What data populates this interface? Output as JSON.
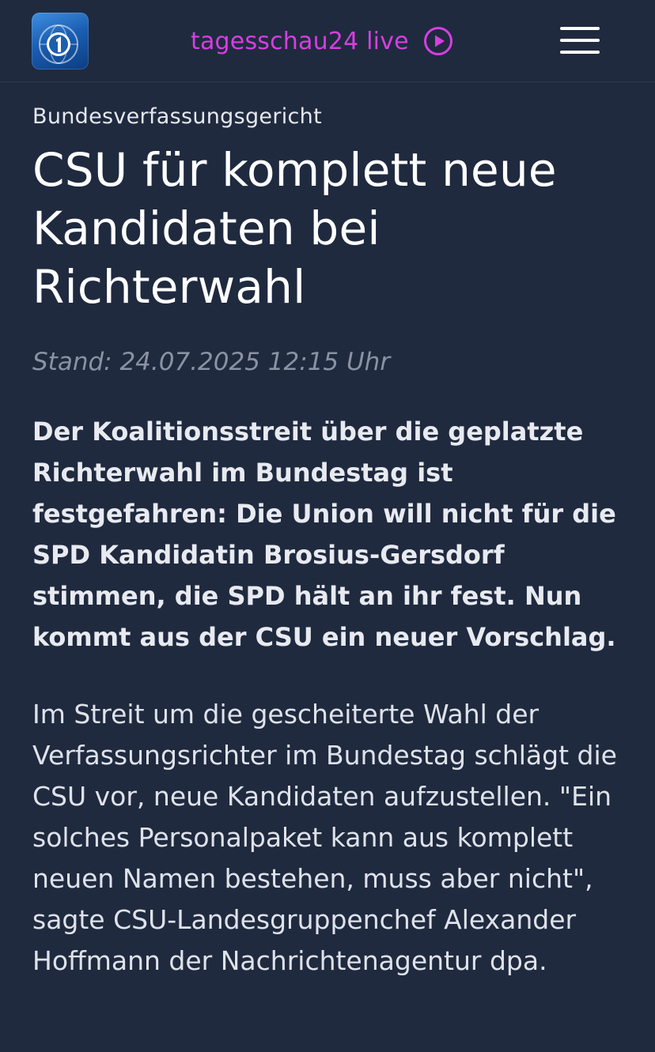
{
  "header": {
    "logo_icon": "tagesschau-logo-icon",
    "live_label": "tagesschau24 live",
    "live_icon": "play-circle-icon",
    "menu_icon": "hamburger-menu-icon",
    "accent_color": "#d63fe0"
  },
  "article": {
    "topline": "Bundesverfassungsgericht",
    "headline": "CSU für komplett neue Kandidaten bei Richterwahl",
    "stand": "Stand: 24.07.2025 12:15 Uhr",
    "lead": "Der Koalitionsstreit über die geplatzte Richterwahl im Bundestag ist festgefahren: Die Union will nicht für die SPD Kandidatin Brosius-Gersdorf stimmen, die SPD hält an ihr fest. Nun kommt aus der CSU ein neuer Vorschlag.",
    "paragraph_1": "Im Streit um die gescheiterte Wahl der Verfassungsrichter im Bundestag schlägt die CSU vor, neue Kandidaten aufzustellen. \"Ein solches Personalpaket kann aus komplett neuen Namen bestehen, muss aber nicht\", sagte CSU-Landesgruppenchef Alexander Hoffmann der Nachrichtenagentur dpa."
  },
  "colors": {
    "background": "#1f2a3f",
    "stand_text": "#8a92a3"
  }
}
